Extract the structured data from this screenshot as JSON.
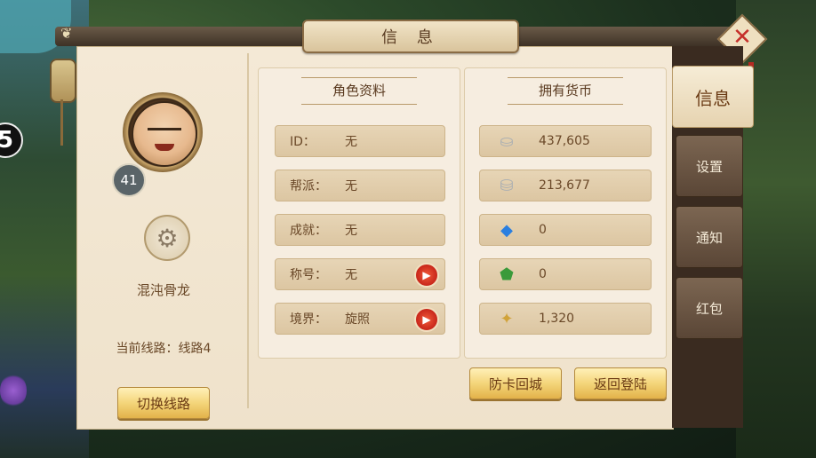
{
  "window": {
    "title": "信 息",
    "close_icon": "close-x-icon"
  },
  "background": {
    "side_number": "5"
  },
  "profile": {
    "level": "41",
    "name": "混沌骨龙",
    "current_line_label": "当前线路：",
    "current_line_value": "线路4",
    "switch_button": "切换线路",
    "settings_icon": "gear-icon"
  },
  "character_info": {
    "header": "角色资料",
    "rows": [
      {
        "label": "ID：",
        "value": "无",
        "has_arrow": false
      },
      {
        "label": "帮派：",
        "value": "无",
        "has_arrow": false
      },
      {
        "label": "成就：",
        "value": "无",
        "has_arrow": false
      },
      {
        "label": "称号：",
        "value": "无",
        "has_arrow": true
      },
      {
        "label": "境界：",
        "value": "旋照",
        "has_arrow": true
      }
    ]
  },
  "currency": {
    "header": "拥有货币",
    "rows": [
      {
        "icon": "silver-ingot-icon",
        "value": "437,605"
      },
      {
        "icon": "locked-silver-ingot-icon",
        "value": "213,677"
      },
      {
        "icon": "diamond-icon",
        "value": "0"
      },
      {
        "icon": "jade-icon",
        "value": "0"
      },
      {
        "icon": "gold-coin-icon",
        "value": "1,320"
      }
    ]
  },
  "buttons": {
    "anti_stuck": "防卡回城",
    "return_login": "返回登陆"
  },
  "tabs": [
    {
      "label": "信息",
      "active": true
    },
    {
      "label": "设置",
      "active": false
    },
    {
      "label": "通知",
      "active": false
    },
    {
      "label": "红包",
      "active": false
    }
  ]
}
